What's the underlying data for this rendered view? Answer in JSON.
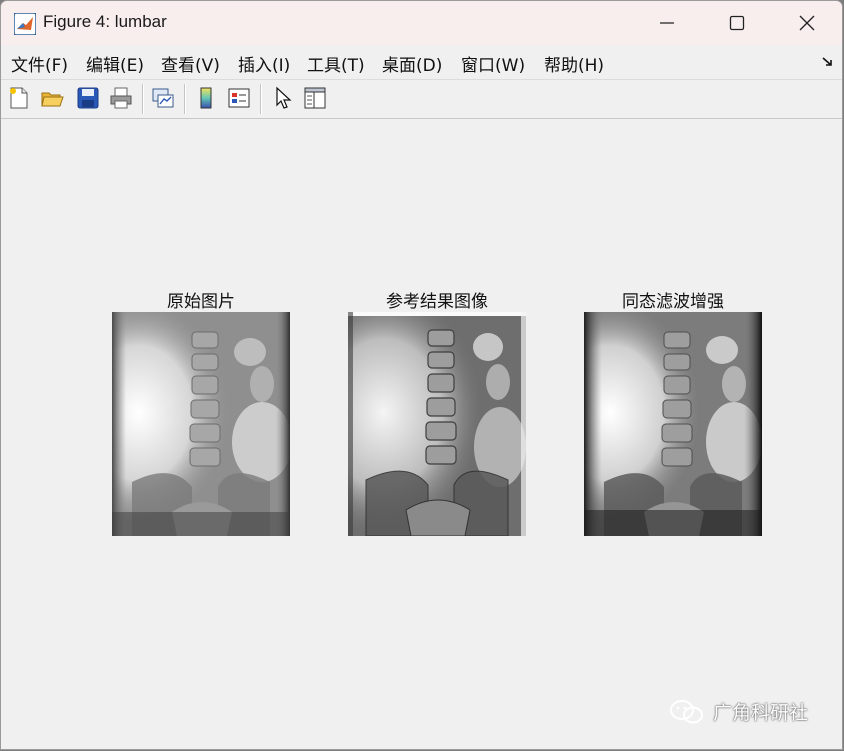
{
  "window": {
    "title": "Figure 4: lumbar"
  },
  "menu": {
    "file": "文件(F)",
    "edit": "编辑(E)",
    "view": "查看(V)",
    "insert": "插入(I)",
    "tools": "工具(T)",
    "desktop": "桌面(D)",
    "window": "窗口(W)",
    "help": "帮助(H)"
  },
  "toolbar": {
    "icons": [
      "new-figure-icon",
      "open-file-icon",
      "save-icon",
      "print-icon",
      "link-plot-icon",
      "colorbar-icon",
      "legend-icon",
      "pointer-icon",
      "property-inspector-icon"
    ]
  },
  "subplots": [
    {
      "title": "原始图片"
    },
    {
      "title": "参考结果图像"
    },
    {
      "title": "同态滤波增强"
    }
  ],
  "watermark": {
    "text": "广角科研社"
  },
  "colors": {
    "titlebar": "#f8eeee",
    "background": "#f0f0f0",
    "accent": "#1f6fbf"
  }
}
